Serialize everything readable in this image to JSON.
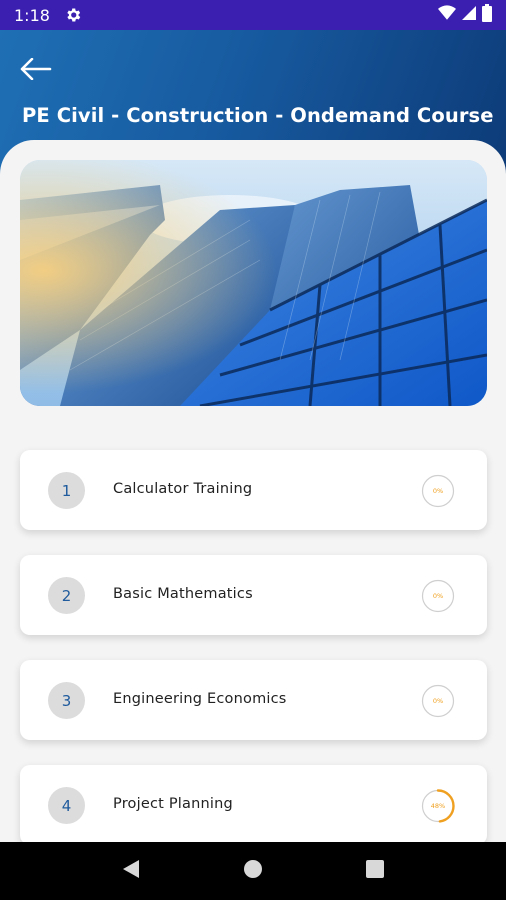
{
  "status_bar": {
    "time": "1:18",
    "icons": [
      "gear-icon",
      "wifi-icon",
      "signal-icon",
      "battery-icon"
    ],
    "color": "#3a1fb0"
  },
  "header": {
    "back_icon": "arrow-left-icon",
    "title": "PE Civil - Construction - Ondemand Course",
    "gradient_colors": [
      "#1f6fb5",
      "#0d3b78"
    ]
  },
  "hero_image": {
    "description_icon": "skyscraper-image"
  },
  "lessons": [
    {
      "number": "1",
      "label": "Calculator Training",
      "progress_text": "0%",
      "progress": 0
    },
    {
      "number": "2",
      "label": "Basic Mathematics",
      "progress_text": "0%",
      "progress": 0
    },
    {
      "number": "3",
      "label": "Engineering Economics",
      "progress_text": "0%",
      "progress": 0
    },
    {
      "number": "4",
      "label": "Project Planning",
      "progress_text": "48%",
      "progress": 0.48
    }
  ],
  "colors": {
    "accent_progress": "#f0a020",
    "number_text": "#1f5b9d"
  },
  "nav_bar": {
    "icons": [
      "back-triangle-icon",
      "home-circle-icon",
      "recents-square-icon"
    ]
  }
}
